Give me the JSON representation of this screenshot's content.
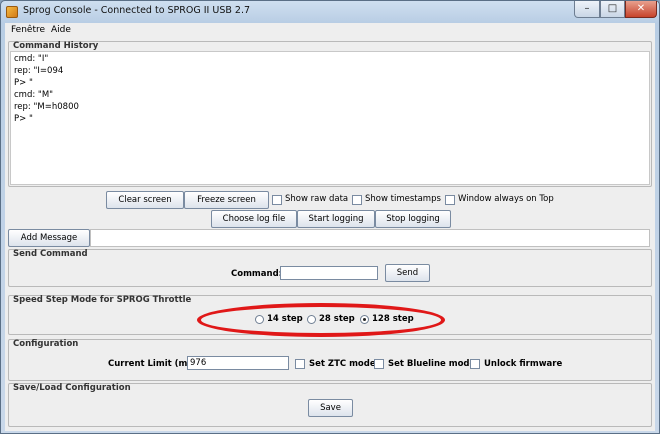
{
  "window": {
    "title": "Sprog Console - Connected to SPROG II USB 2.7",
    "minimize_glyph": "–",
    "maximize_glyph": "□",
    "close_glyph": "✕"
  },
  "menu": {
    "items": [
      "Fenêtre",
      "Aide"
    ]
  },
  "history": {
    "title": "Command History",
    "lines": [
      "cmd: \"I\"",
      "rep: \"I=094",
      "P> \"",
      "cmd: \"M\"",
      "rep: \"M=h0800",
      "P> \""
    ]
  },
  "toolbar": {
    "clear_label": "Clear screen",
    "freeze_label": "Freeze screen",
    "raw_label": "Show raw data",
    "timestamps_label": "Show timestamps",
    "ontop_label": "Window always on Top",
    "logfile_label": "Choose log file",
    "start_label": "Start logging",
    "stop_label": "Stop logging"
  },
  "message": {
    "button_label": "Add Message",
    "value": ""
  },
  "send": {
    "title": "Send Command",
    "command_label": "Command:",
    "command_value": "",
    "send_label": "Send"
  },
  "speed": {
    "title": "Speed Step Mode for SPROG Throttle",
    "options": [
      "14 step",
      "28 step",
      "128 step"
    ],
    "selected": "128 step"
  },
  "config": {
    "title": "Configuration",
    "current_label": "Current Limit (mA):",
    "current_value": "976",
    "ztc_label": "Set ZTC mode",
    "blueline_label": "Set Blueline mode",
    "unlock_label": "Unlock firmware"
  },
  "saveload": {
    "title": "Save/Load Configuration",
    "save_label": "Save"
  }
}
